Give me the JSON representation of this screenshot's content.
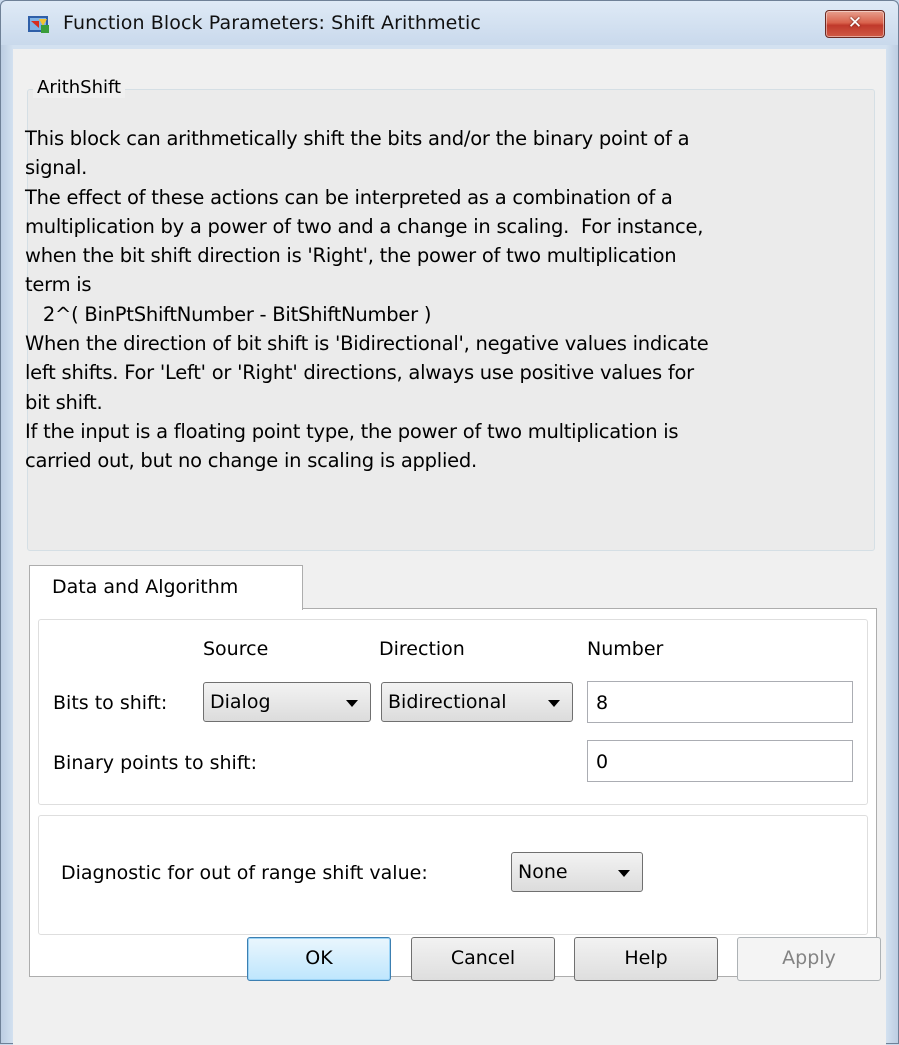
{
  "window": {
    "title": "Function Block Parameters: Shift Arithmetic",
    "close_symbol": "✕",
    "app_icon": "simulink-block-icon"
  },
  "group": {
    "legend": "ArithShift",
    "description_lines": [
      "This block can arithmetically shift the bits and/or the binary point of a",
      "signal.",
      "The effect of these actions can be interpreted as a combination of a",
      "multiplication by a power of two and a change in scaling.  For instance,",
      "when the bit shift direction is 'Right', the power of two multiplication",
      "term is",
      "   2^( BinPtShiftNumber - BitShiftNumber )",
      "When the direction of bit shift is 'Bidirectional', negative values indicate",
      "left shifts. For 'Left' or 'Right' directions, always use positive values for",
      "bit shift.",
      "If the input is a floating point type, the power of two multiplication is",
      "carried out, but no change in scaling is applied."
    ]
  },
  "tabs": [
    {
      "label": "Data and Algorithm",
      "selected": true
    }
  ],
  "params": {
    "col_source": "Source",
    "col_direction": "Direction",
    "col_number": "Number",
    "bits_label": "Bits to shift:",
    "bits_source": "Dialog",
    "bits_direction": "Bidirectional",
    "bits_number": "8",
    "binary_label": "Binary points to shift:",
    "binary_number": "0",
    "diag_label": "Diagnostic for out of range shift value:",
    "diag_value": "None"
  },
  "buttons": {
    "ok": "OK",
    "cancel": "Cancel",
    "help": "Help",
    "apply": "Apply"
  },
  "colors": {
    "title_bar": "#c9d9ec",
    "close_button": "#c9432f",
    "default_button": "#bee6fd"
  }
}
